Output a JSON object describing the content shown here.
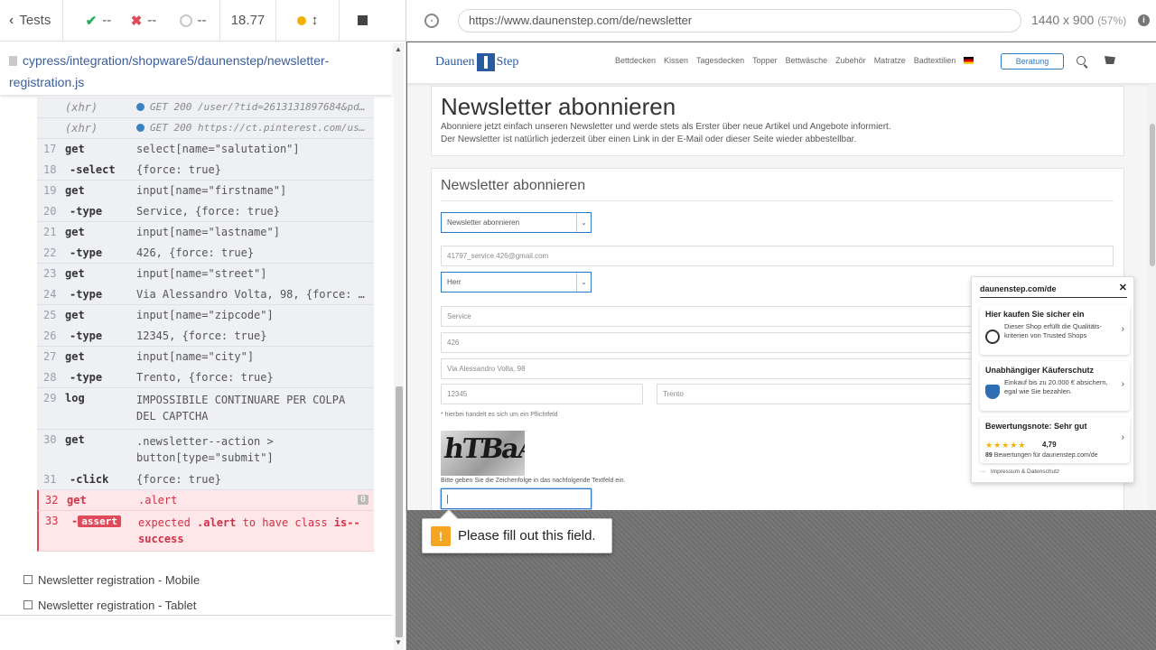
{
  "reporter": {
    "tests_label": "Tests",
    "passed": "--",
    "failed": "--",
    "pending": "--",
    "duration": "18.77",
    "spec_path": "cypress/integration/shopware5/daunenstep/newsletter-registration.js",
    "commands": [
      {
        "num": "",
        "name": "(xhr)",
        "msg": "GET 200 /user/?tid=2613131897684&pd={...",
        "kind": "xhr"
      },
      {
        "num": "",
        "name": "(xhr)",
        "msg": "GET 200 https://ct.pinterest.com/user...",
        "kind": "xhr"
      },
      {
        "num": "17",
        "name": "get",
        "msg": "select[name=\"salutation\"]"
      },
      {
        "num": "18",
        "name": "-select",
        "msg": "{force: true}"
      },
      {
        "num": "19",
        "name": "get",
        "msg": "input[name=\"firstname\"]"
      },
      {
        "num": "20",
        "name": "-type",
        "msg": "Service, {force: true}"
      },
      {
        "num": "21",
        "name": "get",
        "msg": "input[name=\"lastname\"]"
      },
      {
        "num": "22",
        "name": "-type",
        "msg": "426, {force: true}"
      },
      {
        "num": "23",
        "name": "get",
        "msg": "input[name=\"street\"]"
      },
      {
        "num": "24",
        "name": "-type",
        "msg": "Via Alessandro Volta, 98, {force: …"
      },
      {
        "num": "25",
        "name": "get",
        "msg": "input[name=\"zipcode\"]"
      },
      {
        "num": "26",
        "name": "-type",
        "msg": "12345, {force: true}"
      },
      {
        "num": "27",
        "name": "get",
        "msg": "input[name=\"city\"]"
      },
      {
        "num": "28",
        "name": "-type",
        "msg": "Trento, {force: true}"
      },
      {
        "num": "29",
        "name": "log",
        "msg": "IMPOSSIBILE CONTINUARE PER COLPA DEL CAPTCHA"
      },
      {
        "num": "30",
        "name": "get",
        "msg": ".newsletter--action > button[type=\"submit\"]"
      },
      {
        "num": "31",
        "name": "-click",
        "msg": "{force: true}"
      }
    ],
    "error_get": {
      "num": "32",
      "name": "get",
      "msg": ".alert",
      "badge": "0"
    },
    "error_assert": {
      "num": "33",
      "name": "assert",
      "msg_prefix": "expected",
      "selector": ".alert",
      "msg_mid": "to have class",
      "cls": "is--success"
    },
    "other_tests": [
      "Newsletter registration - Mobile",
      "Newsletter registration - Tablet"
    ]
  },
  "app": {
    "url": "https://www.daunenstep.com/de/newsletter",
    "viewport": "1440 x 900",
    "viewport_pct": "(57%)",
    "site": {
      "logo_left": "Daunen",
      "logo_right": "Step",
      "nav": [
        "Bettdecken",
        "Kissen",
        "Tagesdecken",
        "Topper",
        "Bettwäsche",
        "Zubehör",
        "Matratze",
        "Badtextilien"
      ],
      "beratung": "Beratung",
      "hero_title": "Newsletter abonnieren",
      "hero_text_1": "Abonniere jetzt einfach unseren Newsletter und werde stets als Erster über neue Artikel und Angebote informiert.",
      "hero_text_2": "Der Newsletter ist natürlich jederzeit über einen Link in der E-Mail oder dieser Seite wieder abbestellbar.",
      "form_title": "Newsletter abonnieren",
      "subscribe_select": "Newsletter abonnieren",
      "email": "41797_service.426@gmail.com",
      "salutation": "Herr",
      "firstname": "Service",
      "lastname": "426",
      "street": "Via Alessandro Volta, 98",
      "zipcode": "12345",
      "city": "Trento",
      "required_note": "* hierbei handelt es sich um ein Pflichtfeld",
      "captcha_text": "hTBaA",
      "captcha_hint": "Bitte geben Sie die Zeichenfolge in das nachfolgende Textfeld ein."
    },
    "trusted": {
      "domain": "daunenstep.com/de",
      "card1_title": "Hier kaufen Sie sicher ein",
      "card1_text": "Dieser Shop erfüllt die Qualitäts- kriterien von Trusted Shops",
      "card2_title": "Unabhängiger Käuferschutz",
      "card2_text": "Einkauf bis zu 20.000 € absichern, egal wie Sie bezahlen.",
      "card3_title": "Bewertungsnote: Sehr gut",
      "score": "4,79",
      "review_count": "89",
      "review_text": "Bewertungen für daunenstep.com/de",
      "footer": "Impressum & Datenschutz"
    },
    "tooltip": "Please fill out this field."
  },
  "colors": {
    "error": "#e04a5a",
    "link": "#3a5e9a",
    "accent": "#2f79c4",
    "pending_dot": "#f2b102"
  }
}
